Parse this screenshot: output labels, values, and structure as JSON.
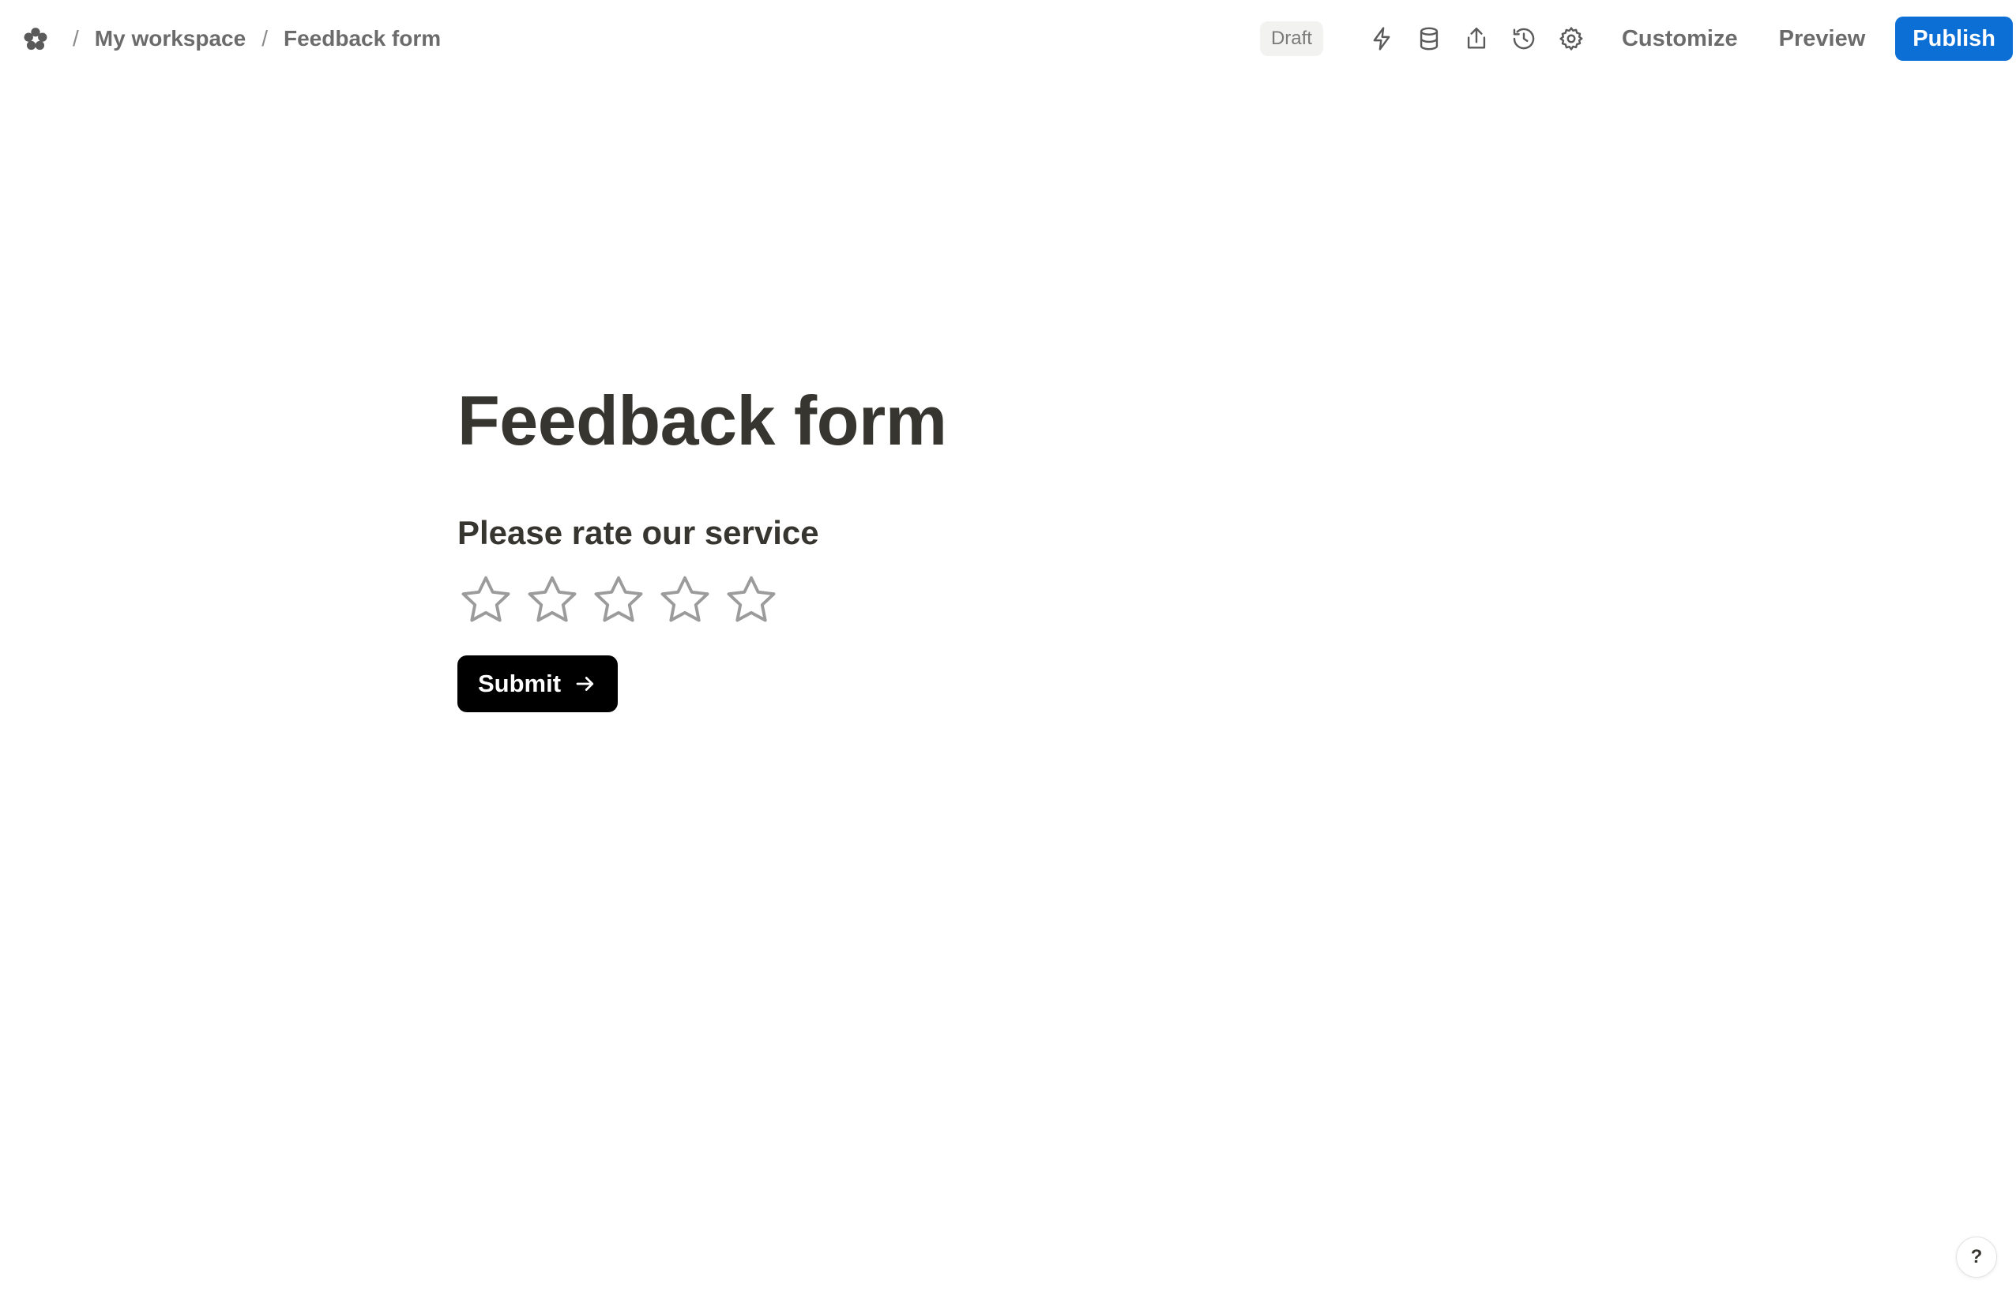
{
  "breadcrumb": {
    "separator": "/",
    "workspace": "My workspace",
    "form": "Feedback form"
  },
  "toolbar": {
    "status_badge": "Draft",
    "icons": [
      "lightning-icon",
      "database-icon",
      "share-icon",
      "history-icon",
      "settings-icon"
    ],
    "customize_label": "Customize",
    "preview_label": "Preview",
    "publish_label": "Publish"
  },
  "form": {
    "title": "Feedback form",
    "question": "Please rate our service",
    "rating": {
      "max": 5,
      "value": 0
    },
    "submit_label": "Submit"
  },
  "help": {
    "label": "?"
  },
  "colors": {
    "publish_bg": "#0b6fd6",
    "submit_bg": "#000000",
    "text": "#37352f",
    "muted_text": "#6b6b6b",
    "star_outline": "#9b9b9b",
    "badge_bg": "#f2f2f1"
  }
}
